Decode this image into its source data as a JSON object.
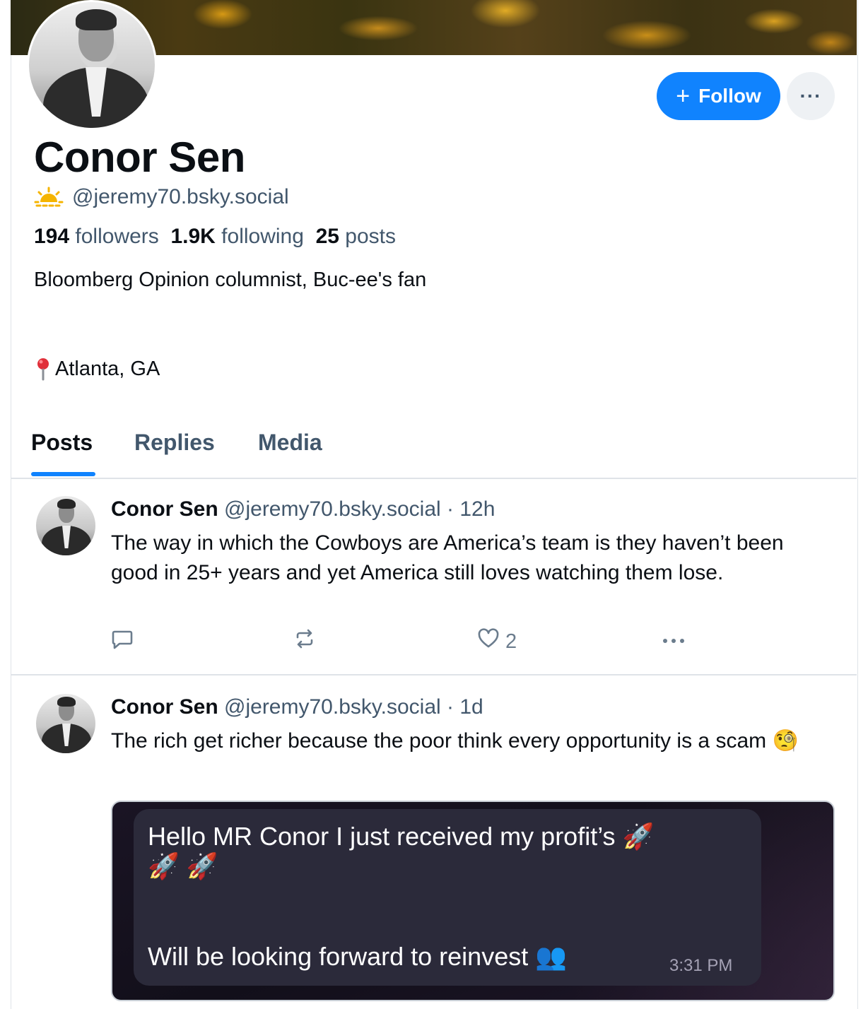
{
  "profile": {
    "name": "Conor Sen",
    "handle": "@jeremy70.bsky.social",
    "followers_count": "194",
    "followers_label": "followers",
    "following_count": "1.9K",
    "following_label": "following",
    "posts_count": "25",
    "posts_label": "posts",
    "bio": "Bloomberg Opinion columnist, Buc-ee's fan",
    "location": "Atlanta, GA",
    "handle_icon": "sun-icon",
    "location_icon": "pin-icon"
  },
  "actions": {
    "follow_label": "Follow",
    "more_label": "···"
  },
  "tabs": [
    {
      "label": "Posts",
      "active": true
    },
    {
      "label": "Replies",
      "active": false
    },
    {
      "label": "Media",
      "active": false
    }
  ],
  "posts": [
    {
      "author": "Conor Sen",
      "handle": "@jeremy70.bsky.social",
      "time": "· 12h",
      "text": "The way in which the Cowboys are America’s team is they haven’t been good in 25+ years and yet America still loves watching them lose.",
      "like_count": "2"
    },
    {
      "author": "Conor Sen",
      "handle": "@jeremy70.bsky.social",
      "time": "· 1d",
      "text": "The rich get richer because the poor think every opportunity is a scam 🧐",
      "embed": {
        "line1": "Hello MR Conor I just received my profit’s 🚀",
        "line1b": "🚀 🚀",
        "line2": "Will be looking forward to reinvest 👥",
        "time": "3:31 PM"
      }
    }
  ],
  "colors": {
    "accent": "#1083fe",
    "muted": "#42576c",
    "text": "#0b0f14"
  }
}
